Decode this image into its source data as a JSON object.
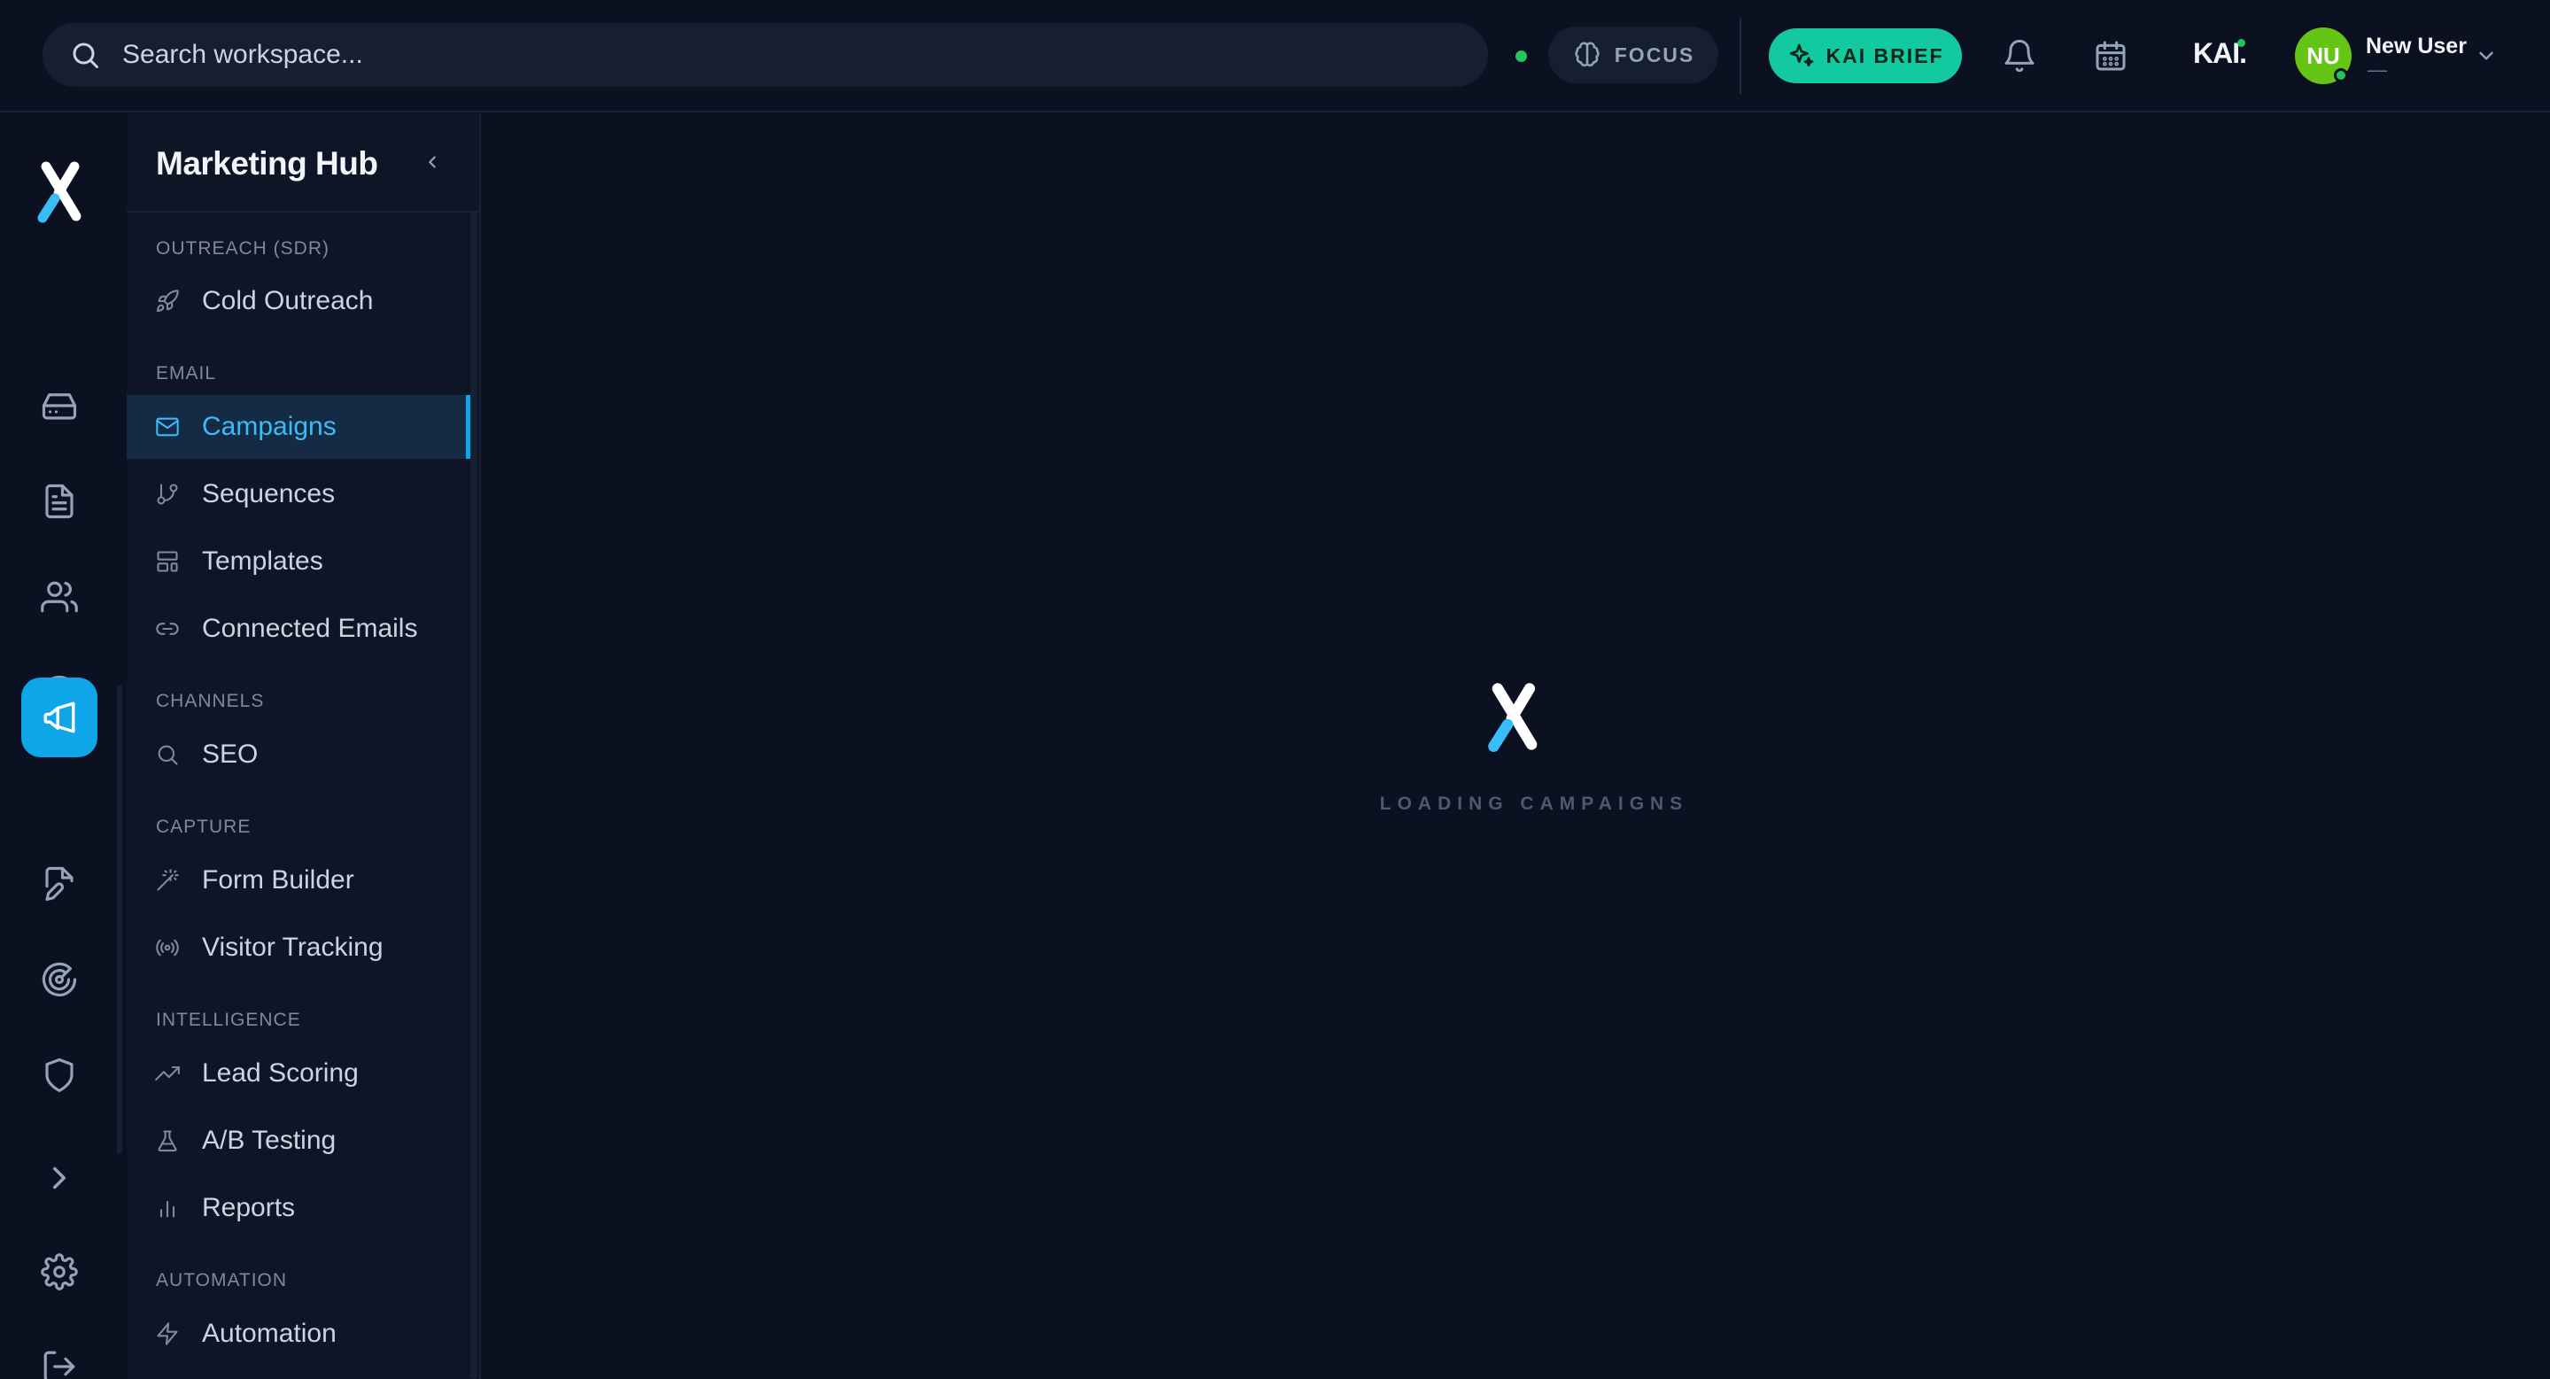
{
  "header": {
    "search_placeholder": "Search workspace...",
    "focus_label": "FOCUS",
    "kai_brief_label": "KAI BRIEF",
    "kai_logo": "KAI.",
    "user": {
      "initials": "NU",
      "name": "New User",
      "subtitle": "—"
    }
  },
  "sidebar": {
    "title": "Marketing Hub",
    "sections": [
      {
        "label": "OUTREACH (SDR)",
        "items": [
          {
            "label": "Cold Outreach",
            "icon": "rocket-icon"
          }
        ]
      },
      {
        "label": "EMAIL",
        "items": [
          {
            "label": "Campaigns",
            "icon": "mail-icon",
            "active": true
          },
          {
            "label": "Sequences",
            "icon": "git-branch-icon"
          },
          {
            "label": "Templates",
            "icon": "layout-template-icon"
          },
          {
            "label": "Connected Emails",
            "icon": "link-icon"
          }
        ]
      },
      {
        "label": "CHANNELS",
        "items": [
          {
            "label": "SEO",
            "icon": "search-icon"
          }
        ]
      },
      {
        "label": "CAPTURE",
        "items": [
          {
            "label": "Form Builder",
            "icon": "wand-icon"
          },
          {
            "label": "Visitor Tracking",
            "icon": "radio-icon"
          }
        ]
      },
      {
        "label": "INTELLIGENCE",
        "items": [
          {
            "label": "Lead Scoring",
            "icon": "trending-up-icon"
          },
          {
            "label": "A/B Testing",
            "icon": "flask-icon"
          },
          {
            "label": "Reports",
            "icon": "bar-chart-icon"
          }
        ]
      },
      {
        "label": "AUTOMATION",
        "items": [
          {
            "label": "Automation",
            "icon": "zap-icon"
          }
        ]
      }
    ]
  },
  "main": {
    "loading_text": "LOADING CAMPAIGNS"
  },
  "colors": {
    "accent": "#0ea5e9",
    "brief": "#12c9a0",
    "avatar": "#65c514",
    "online": "#22c55e"
  }
}
